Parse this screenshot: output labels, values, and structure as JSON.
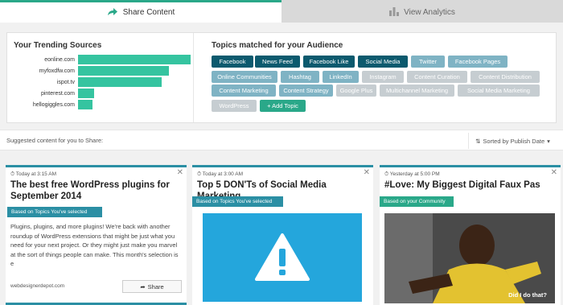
{
  "tabs": {
    "share": {
      "label": "Share Content",
      "icon": "share-arrow-icon"
    },
    "analytics": {
      "label": "View Analytics",
      "icon": "bar-chart-icon"
    }
  },
  "sources": {
    "title": "Your Trending Sources",
    "items": [
      {
        "name": "eonline.com",
        "value": 1.0
      },
      {
        "name": "myfoxdfw.com",
        "value": 0.81
      },
      {
        "name": "ispot.tv",
        "value": 0.74
      },
      {
        "name": "pinterest.com",
        "value": 0.14
      },
      {
        "name": "hellogiggles.com",
        "value": 0.13
      }
    ]
  },
  "topics": {
    "title": "Topics matched for your Audience",
    "items": [
      {
        "label": "Facebook",
        "style": "dark"
      },
      {
        "label": "News Feed",
        "style": "dark"
      },
      {
        "label": "Facebook Like",
        "style": "dark"
      },
      {
        "label": "Social Media",
        "style": "dark"
      },
      {
        "label": "Twitter",
        "style": "light"
      },
      {
        "label": "Facebook Pages",
        "style": "light"
      },
      {
        "label": "Online Communities",
        "style": "light"
      },
      {
        "label": "Hashtag",
        "style": "light"
      },
      {
        "label": "LinkedIn",
        "style": "light"
      },
      {
        "label": "Instagram",
        "style": "pale"
      },
      {
        "label": "Content Curation",
        "style": "pale"
      },
      {
        "label": "Content Distribution",
        "style": "pale"
      },
      {
        "label": "Content Marketing",
        "style": "light"
      },
      {
        "label": "Content Strategy",
        "style": "light"
      },
      {
        "label": "Google Plus",
        "style": "pale"
      },
      {
        "label": "Multichannel Marketing",
        "style": "pale"
      },
      {
        "label": "Social Media Marketing",
        "style": "pale"
      },
      {
        "label": "WordPress",
        "style": "pale"
      }
    ],
    "add_label": "+ Add Topic"
  },
  "suggest": {
    "text": "Suggested content for you to Share:",
    "sort_label": "Sorted by Publish Date"
  },
  "cards": [
    {
      "time": "Today at 3:15 AM",
      "title": "The best free WordPress plugins for September 2014",
      "ribbon": "Based on Topics You've selected",
      "desc": "Plugins, plugins, and more plugins! We're back with another roundup of WordPress extensions that might be just what you need for your next project. Or they might just make you marvel at the sort of things people can make. This month's selection is e",
      "source": "webdesignerdepot.com",
      "share_label": "Share"
    },
    {
      "time": "Today at 3:00 AM",
      "title": "Top 5 DON'Ts of Social Media Marketing",
      "ribbon": "Based on Topics You've selected"
    },
    {
      "time": "Yesterday at 5:00 PM",
      "title": "#Love: My Biggest Digital Faux Pas",
      "ribbon": "Based on your Community",
      "caption": "Did I do that?"
    }
  ],
  "colors": {
    "accent": "#2aa889",
    "dark": "#0c5a6e",
    "light": "#7fb3c4",
    "pale": "#c6cdd1",
    "bar": "#35c4a0"
  }
}
